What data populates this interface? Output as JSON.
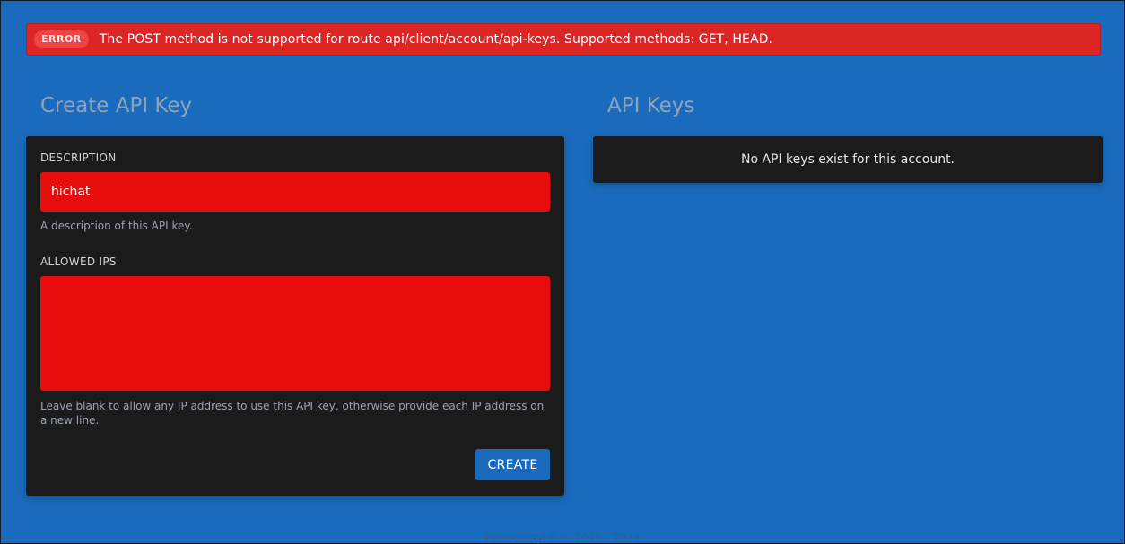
{
  "error": {
    "badge": "ERROR",
    "message": "The POST method is not supported for route api/client/account/api-keys. Supported methods: GET, HEAD."
  },
  "create_section": {
    "title": "Create API Key",
    "description_label": "DESCRIPTION",
    "description_value": "hichat",
    "description_help": "A description of this API key.",
    "allowed_ips_label": "ALLOWED IPS",
    "allowed_ips_value": "",
    "allowed_ips_help": "Leave blank to allow any IP address to use this API key, otherwise provide each IP address on a new line.",
    "create_button": "CREATE"
  },
  "keys_section": {
    "title": "API Keys",
    "empty_message": "No API keys exist for this account."
  },
  "footer": {
    "text": "Pterodactyl® © 2015 - 2023"
  },
  "colors": {
    "background": "#1a6bbd",
    "error": "#dc2626",
    "input_error": "#e80c0c",
    "panel": "#1b1b1c",
    "button": "#1a6bbd"
  }
}
